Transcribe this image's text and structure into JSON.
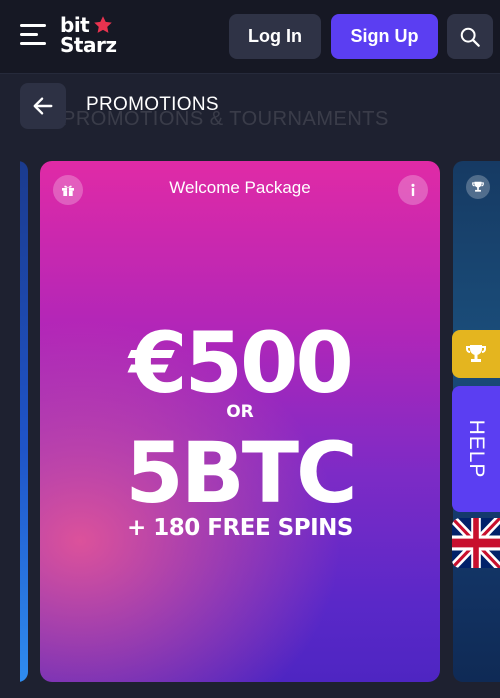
{
  "header": {
    "logo": {
      "line1": "bit",
      "line2": "Starz"
    },
    "menu_icon": "hamburger-menu-icon",
    "login_label": "Log In",
    "signup_label": "Sign Up",
    "search_icon": "search-icon"
  },
  "page": {
    "title": "PROMOTIONS",
    "ghost_subtitle": "PROMOTIONS & TOURNAMENTS",
    "back_icon": "arrow-left-icon"
  },
  "promo_card": {
    "title": "Welcome Package",
    "amount": "€500",
    "or": "OR",
    "btc": "5BTC",
    "spins": "+ 180 FREE SPINS",
    "left_icon": "gift-icon",
    "right_icon": "info-icon"
  },
  "side_widgets": {
    "help_label": "HELP",
    "trophy_icon": "trophy-icon",
    "flag_icon": "uk-flag-icon"
  },
  "colors": {
    "background": "#1e2130",
    "header": "#161824",
    "accent": "#5b3ef2",
    "button_dark": "#2f3346",
    "trophy": "#e4b51f",
    "card_top": "#e02aa6",
    "card_bottom": "#4e25c2"
  }
}
